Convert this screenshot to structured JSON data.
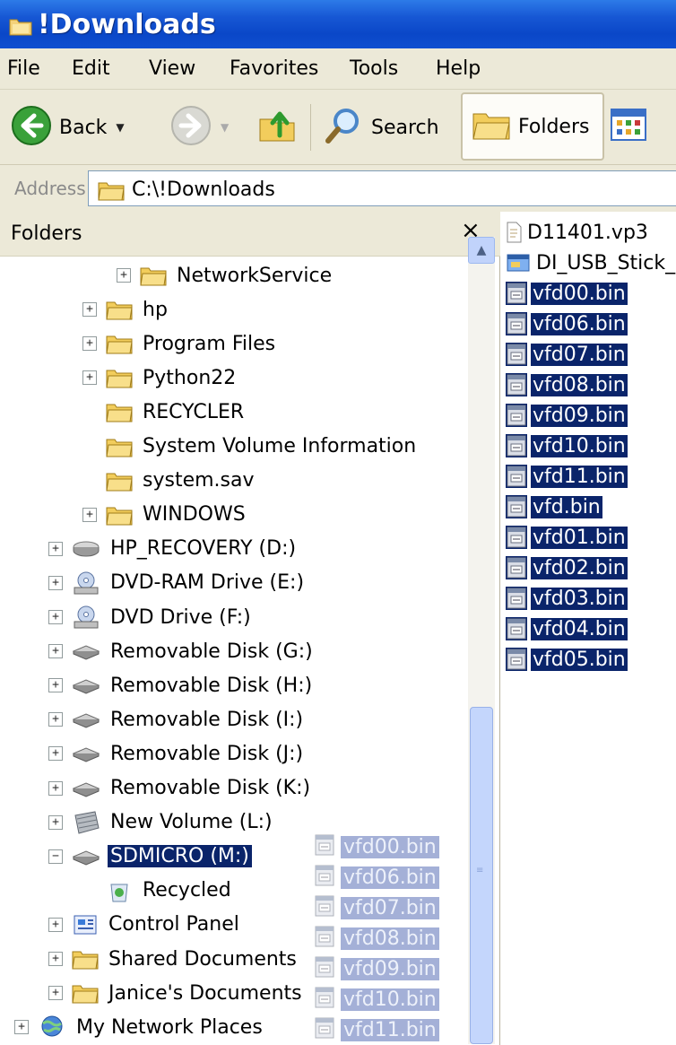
{
  "window": {
    "title": "!Downloads"
  },
  "menu": [
    "File",
    "Edit",
    "View",
    "Favorites",
    "Tools",
    "Help"
  ],
  "toolbar": {
    "back": "Back",
    "search": "Search",
    "folders": "Folders"
  },
  "address": {
    "label": "Address",
    "path": "C:\\!Downloads"
  },
  "folders_pane": {
    "title": "Folders",
    "close": "×",
    "tree": [
      {
        "label": "NetworkService",
        "expander": "+",
        "icon": "folder-icon"
      },
      {
        "label": "hp",
        "expander": "+",
        "icon": "folder-icon"
      },
      {
        "label": "Program Files",
        "expander": "+",
        "icon": "folder-icon"
      },
      {
        "label": "Python22",
        "expander": "+",
        "icon": "folder-icon"
      },
      {
        "label": "RECYCLER",
        "expander": "",
        "icon": "folder-icon"
      },
      {
        "label": "System Volume Information",
        "expander": "",
        "icon": "folder-icon"
      },
      {
        "label": "system.sav",
        "expander": "",
        "icon": "folder-icon"
      },
      {
        "label": "WINDOWS",
        "expander": "+",
        "icon": "folder-icon"
      },
      {
        "label": "HP_RECOVERY (D:)",
        "expander": "+",
        "icon": "hard-drive-icon"
      },
      {
        "label": "DVD-RAM Drive (E:)",
        "expander": "+",
        "icon": "dvd-drive-icon"
      },
      {
        "label": "DVD Drive (F:)",
        "expander": "+",
        "icon": "dvd-drive-icon"
      },
      {
        "label": "Removable Disk (G:)",
        "expander": "+",
        "icon": "removable-disk-icon"
      },
      {
        "label": "Removable Disk (H:)",
        "expander": "+",
        "icon": "removable-disk-icon"
      },
      {
        "label": "Removable Disk (I:)",
        "expander": "+",
        "icon": "removable-disk-icon"
      },
      {
        "label": "Removable Disk (J:)",
        "expander": "+",
        "icon": "removable-disk-icon"
      },
      {
        "label": "Removable Disk (K:)",
        "expander": "+",
        "icon": "removable-disk-icon"
      },
      {
        "label": "New Volume (L:)",
        "expander": "+",
        "icon": "volume-icon"
      },
      {
        "label": "SDMICRO (M:)",
        "expander": "−",
        "icon": "removable-disk-icon",
        "selected": true
      },
      {
        "label": "Recycled",
        "expander": "",
        "icon": "recycle-bin-icon"
      },
      {
        "label": "Control Panel",
        "expander": "+",
        "icon": "control-panel-icon"
      },
      {
        "label": "Shared Documents",
        "expander": "+",
        "icon": "folder-icon"
      },
      {
        "label": "Janice's Documents",
        "expander": "+",
        "icon": "folder-icon"
      },
      {
        "label": "My Network Places",
        "expander": "+",
        "icon": "network-places-icon"
      }
    ]
  },
  "drag_ghost": [
    "vfd00.bin",
    "vfd06.bin",
    "vfd07.bin",
    "vfd08.bin",
    "vfd09.bin",
    "vfd10.bin",
    "vfd11.bin"
  ],
  "files": [
    {
      "name": "D11401.vp3",
      "icon": "document-icon",
      "selected": false
    },
    {
      "name": "DI_USB_Stick_",
      "icon": "installer-icon",
      "selected": false
    },
    {
      "name": "vfd00.bin",
      "icon": "bin-file-icon",
      "selected": true
    },
    {
      "name": "vfd06.bin",
      "icon": "bin-file-icon",
      "selected": true
    },
    {
      "name": "vfd07.bin",
      "icon": "bin-file-icon",
      "selected": true
    },
    {
      "name": "vfd08.bin",
      "icon": "bin-file-icon",
      "selected": true
    },
    {
      "name": "vfd09.bin",
      "icon": "bin-file-icon",
      "selected": true
    },
    {
      "name": "vfd10.bin",
      "icon": "bin-file-icon",
      "selected": true
    },
    {
      "name": "vfd11.bin",
      "icon": "bin-file-icon",
      "selected": true
    },
    {
      "name": "vfd.bin",
      "icon": "bin-file-icon",
      "selected": true
    },
    {
      "name": "vfd01.bin",
      "icon": "bin-file-icon",
      "selected": true
    },
    {
      "name": "vfd02.bin",
      "icon": "bin-file-icon",
      "selected": true
    },
    {
      "name": "vfd03.bin",
      "icon": "bin-file-icon",
      "selected": true
    },
    {
      "name": "vfd04.bin",
      "icon": "bin-file-icon",
      "selected": true
    },
    {
      "name": "vfd05.bin",
      "icon": "bin-file-icon",
      "selected": true
    }
  ],
  "colors": {
    "titlebar": "#0a47c8",
    "chrome": "#ece9d8",
    "selection": "#0a246a"
  }
}
